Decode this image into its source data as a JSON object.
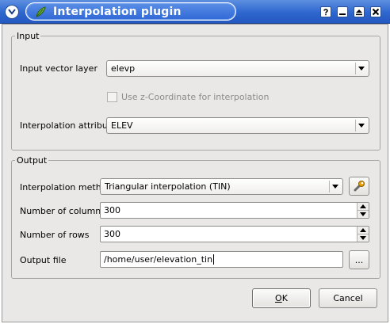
{
  "window": {
    "title": "Interpolation plugin"
  },
  "input_group": {
    "legend": "Input",
    "vector_layer_label": "Input vector layer",
    "vector_layer_value": "elevp",
    "use_z_label": "Use z-Coordinate for interpolation",
    "use_z_checked": false,
    "attribute_label": "Interpolation attribute",
    "attribute_value": "ELEV"
  },
  "output_group": {
    "legend": "Output",
    "method_label": "Interpolation method",
    "method_value": "Triangular interpolation (TIN)",
    "columns_label": "Number of columns",
    "columns_value": "300",
    "rows_label": "Number of rows",
    "rows_value": "300",
    "output_file_label": "Output file",
    "output_file_value": "/home/user/elevation_tin",
    "browse_label": "..."
  },
  "buttons": {
    "ok_accel": "O",
    "ok_rest": "K",
    "cancel": "Cancel"
  },
  "icons": {
    "menu": "chevron-down-icon",
    "app": "plugin-leaf-icon",
    "help": "help-icon",
    "minimize": "minimize-icon",
    "maximize": "maximize-icon",
    "close": "close-icon",
    "config": "wrench-icon"
  },
  "colors": {
    "titlebar": "#2e67cf",
    "dialog_bg": "#e9e8e6"
  }
}
